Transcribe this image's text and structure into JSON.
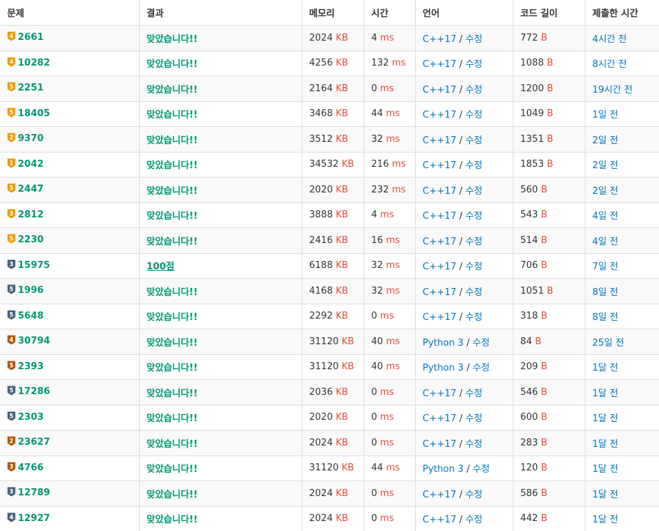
{
  "headers": [
    "문제",
    "결과",
    "메모리",
    "시간",
    "언어",
    "코드 길이",
    "제출한 시간"
  ],
  "units": {
    "memory": "KB",
    "time": "ms",
    "length": "B"
  },
  "edit_label": "수정",
  "tier_colors": {
    "gold": "#EC9A00",
    "silver": "#435F7A",
    "bronze": "#AD5600"
  },
  "rows": [
    {
      "tier": "gold",
      "level": "4",
      "problem": "2661",
      "result": "맞았습니다!!",
      "memory": "2024",
      "time": "4",
      "lang": "C++17",
      "length": "772",
      "submitted": "4시간 전"
    },
    {
      "tier": "gold",
      "level": "4",
      "problem": "10282",
      "result": "맞았습니다!!",
      "memory": "4256",
      "time": "132",
      "lang": "C++17",
      "length": "1088",
      "submitted": "8시간 전"
    },
    {
      "tier": "gold",
      "level": "5",
      "problem": "2251",
      "result": "맞았습니다!!",
      "memory": "2164",
      "time": "0",
      "lang": "C++17",
      "length": "1200",
      "submitted": "19시간 전"
    },
    {
      "tier": "gold",
      "level": "5",
      "problem": "18405",
      "result": "맞았습니다!!",
      "memory": "3468",
      "time": "44",
      "lang": "C++17",
      "length": "1049",
      "submitted": "1일 전"
    },
    {
      "tier": "gold",
      "level": "2",
      "problem": "9370",
      "result": "맞았습니다!!",
      "memory": "3512",
      "time": "32",
      "lang": "C++17",
      "length": "1351",
      "submitted": "2일 전"
    },
    {
      "tier": "gold",
      "level": "1",
      "problem": "2042",
      "result": "맞았습니다!!",
      "memory": "34532",
      "time": "216",
      "lang": "C++17",
      "length": "1853",
      "submitted": "2일 전"
    },
    {
      "tier": "gold",
      "level": "5",
      "problem": "2447",
      "result": "맞았습니다!!",
      "memory": "2020",
      "time": "232",
      "lang": "C++17",
      "length": "560",
      "submitted": "2일 전"
    },
    {
      "tier": "gold",
      "level": "3",
      "problem": "2812",
      "result": "맞았습니다!!",
      "memory": "3888",
      "time": "4",
      "lang": "C++17",
      "length": "543",
      "submitted": "4일 전"
    },
    {
      "tier": "gold",
      "level": "5",
      "problem": "2230",
      "result": "맞았습니다!!",
      "memory": "2416",
      "time": "16",
      "lang": "C++17",
      "length": "514",
      "submitted": "4일 전"
    },
    {
      "tier": "silver",
      "level": "3",
      "problem": "15975",
      "result": "100점",
      "partial": true,
      "memory": "6188",
      "time": "32",
      "lang": "C++17",
      "length": "706",
      "submitted": "7일 전"
    },
    {
      "tier": "silver",
      "level": "5",
      "problem": "1996",
      "result": "맞았습니다!!",
      "memory": "4168",
      "time": "32",
      "lang": "C++17",
      "length": "1051",
      "submitted": "8일 전"
    },
    {
      "tier": "silver",
      "level": "5",
      "problem": "5648",
      "result": "맞았습니다!!",
      "memory": "2292",
      "time": "0",
      "lang": "C++17",
      "length": "318",
      "submitted": "8일 전"
    },
    {
      "tier": "bronze",
      "level": "4",
      "problem": "30794",
      "result": "맞았습니다!!",
      "memory": "31120",
      "time": "40",
      "lang": "Python 3",
      "length": "84",
      "submitted": "25일 전"
    },
    {
      "tier": "bronze",
      "level": "5",
      "problem": "2393",
      "result": "맞았습니다!!",
      "memory": "31120",
      "time": "40",
      "lang": "Python 3",
      "length": "209",
      "submitted": "1달 전"
    },
    {
      "tier": "silver",
      "level": "5",
      "problem": "17286",
      "result": "맞았습니다!!",
      "memory": "2036",
      "time": "0",
      "lang": "C++17",
      "length": "546",
      "submitted": "1달 전"
    },
    {
      "tier": "silver",
      "level": "5",
      "problem": "2303",
      "result": "맞았습니다!!",
      "memory": "2020",
      "time": "0",
      "lang": "C++17",
      "length": "600",
      "submitted": "1달 전"
    },
    {
      "tier": "bronze",
      "level": "2",
      "problem": "23627",
      "result": "맞았습니다!!",
      "memory": "2024",
      "time": "0",
      "lang": "C++17",
      "length": "283",
      "submitted": "1달 전"
    },
    {
      "tier": "bronze",
      "level": "3",
      "problem": "4766",
      "result": "맞았습니다!!",
      "memory": "31120",
      "time": "44",
      "lang": "Python 3",
      "length": "120",
      "submitted": "1달 전"
    },
    {
      "tier": "silver",
      "level": "3",
      "problem": "12789",
      "result": "맞았습니다!!",
      "memory": "2024",
      "time": "0",
      "lang": "C++17",
      "length": "586",
      "submitted": "1달 전"
    },
    {
      "tier": "silver",
      "level": "4",
      "problem": "12927",
      "result": "맞았습니다!!",
      "memory": "2024",
      "time": "0",
      "lang": "C++17",
      "length": "442",
      "submitted": "1달 전"
    }
  ]
}
